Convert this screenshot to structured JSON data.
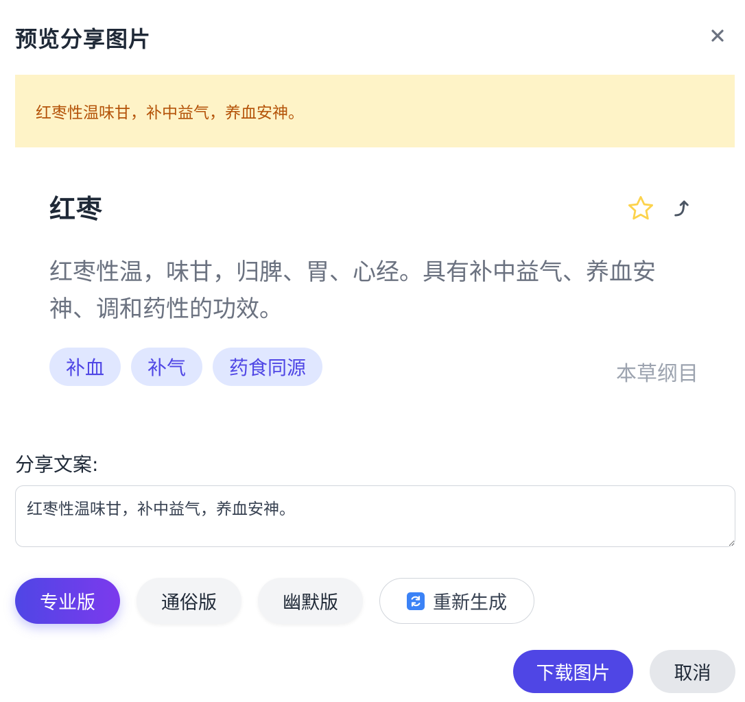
{
  "dialog": {
    "title": "预览分享图片",
    "close_icon": "close-icon"
  },
  "banner": {
    "text": "红枣性温味甘，补中益气，养血安神。"
  },
  "card": {
    "title": "红枣",
    "description": "红枣性温，味甘，归脾、胃、心经。具有补中益气、养血安神、调和药性的功效。",
    "tags": [
      "补血",
      "补气",
      "药食同源"
    ],
    "source": "本草纲目",
    "actions": {
      "favorite_icon": "star-outline-icon",
      "share_icon": "share-arrow-icon"
    }
  },
  "share": {
    "label": "分享文案:",
    "text": "红枣性温味甘，补中益气，养血安神。"
  },
  "styles": {
    "professional": "专业版",
    "popular": "通俗版",
    "humor": "幽默版",
    "regenerate": "重新生成",
    "regenerate_icon": "refresh-icon"
  },
  "footer": {
    "download": "下载图片",
    "cancel": "取消"
  },
  "colors": {
    "accent": "#4f46e5",
    "banner_bg": "#fef3c7",
    "banner_text": "#b45309",
    "tag_bg": "#e0e7ff",
    "star": "#fcd34d"
  }
}
